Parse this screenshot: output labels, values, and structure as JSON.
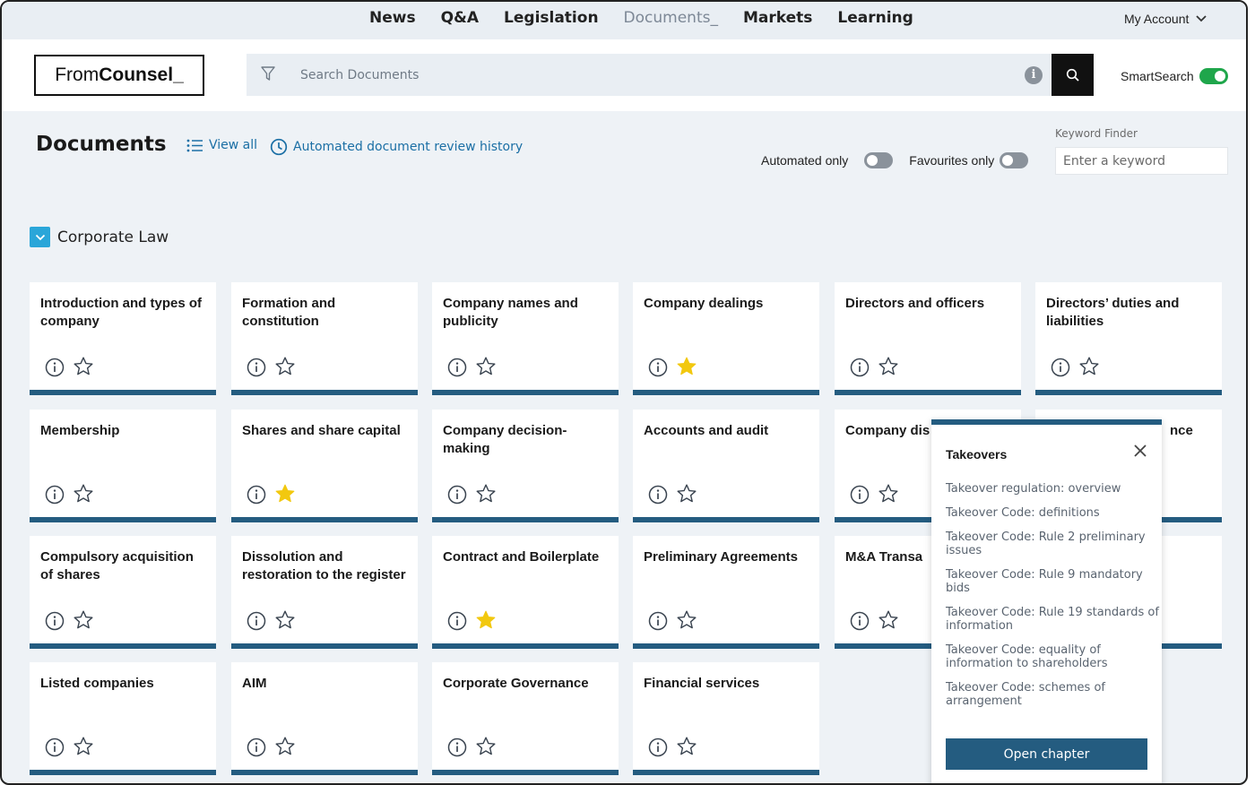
{
  "topnav": {
    "links": [
      "News",
      "Q&A",
      "Legislation",
      "Documents_",
      "Markets",
      "Learning"
    ],
    "active_index": 3,
    "account_label": "My Account"
  },
  "header": {
    "logo_regular": "From",
    "logo_bold": "Counsel_",
    "search_placeholder": "Search Documents",
    "info_glyph": "i",
    "smartsearch_label": "SmartSearch",
    "smartsearch_on": true
  },
  "page": {
    "title": "Documents",
    "view_all": "View all",
    "history": "Automated document review history",
    "automated_only": "Automated only",
    "favourites_only": "Favourites only",
    "keyword_label": "Keyword Finder",
    "keyword_placeholder": "Enter a keyword"
  },
  "section": {
    "label": "Corporate Law",
    "checked": true
  },
  "cards": [
    {
      "title": "Introduction and types of company",
      "fav": false
    },
    {
      "title": "Formation and constitution",
      "fav": false
    },
    {
      "title": "Company names and publicity",
      "fav": false
    },
    {
      "title": "Company dealings",
      "fav": true
    },
    {
      "title": "Directors and officers",
      "fav": false
    },
    {
      "title": "Directors’ duties and liabilities",
      "fav": false
    },
    {
      "title": "Membership",
      "fav": false
    },
    {
      "title": "Shares and share capital",
      "fav": true
    },
    {
      "title": "Company decision-making",
      "fav": false
    },
    {
      "title": "Accounts and audit",
      "fav": false
    },
    {
      "title": "Company dis",
      "fav": false
    },
    {
      "title": "nce",
      "fav": false
    },
    {
      "title": "Compulsory acquisition of shares",
      "fav": false
    },
    {
      "title": "Dissolution and restoration to the register",
      "fav": false
    },
    {
      "title": "Contract and Boilerplate",
      "fav": true
    },
    {
      "title": "Preliminary Agreements",
      "fav": false
    },
    {
      "title": "M&A Transa",
      "fav": false
    },
    {
      "title": "",
      "fav": false
    },
    {
      "title": "Listed companies",
      "fav": false
    },
    {
      "title": "AIM",
      "fav": false
    },
    {
      "title": "Corporate Governance",
      "fav": false
    },
    {
      "title": "Financial services",
      "fav": false
    }
  ],
  "popover": {
    "title": "Takeovers",
    "items": [
      "Takeover regulation: overview",
      "Takeover Code: definitions",
      "Takeover Code: Rule 2 preliminary issues",
      "Takeover Code: Rule 9 mandatory bids",
      "Takeover Code: Rule 19 standards of information",
      "Takeover Code: equality of information to shareholders",
      "Takeover Code: schemes of arrangement"
    ],
    "button": "Open chapter"
  },
  "colors": {
    "accent": "#245c80",
    "link": "#1b6fa5",
    "star": "#f2c80f",
    "toggle_on": "#1fa64b"
  }
}
